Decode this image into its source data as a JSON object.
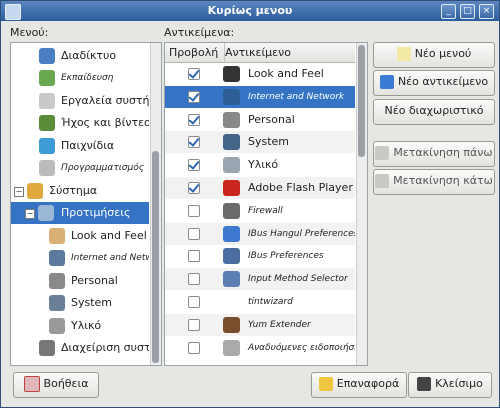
{
  "window": {
    "title": "Κυρίως μενου"
  },
  "menus_panel": {
    "label": "Μενού:",
    "items": [
      {
        "label": "Διαδίκτυο",
        "icon": "internet-globe-icon"
      },
      {
        "label": "Εκπαίδευση",
        "icon": "education-icon"
      },
      {
        "label": "Εργαλεία συστήμ",
        "icon": "system-tools-icon"
      },
      {
        "label": "Ήχος και βίντεο",
        "icon": "sound-video-icon"
      },
      {
        "label": "Παιχνίδια",
        "icon": "games-icon"
      },
      {
        "label": "Προγραμματισμός",
        "icon": "programming-icon"
      },
      {
        "label": "Σύστημα",
        "icon": "system-icon",
        "expander": "−"
      },
      {
        "label": "Προτιμήσεις",
        "icon": "preferences-icon",
        "expander": "−"
      },
      {
        "label": "Look and Feel",
        "icon": "look-and-feel-icon"
      },
      {
        "label": "Internet and Netw",
        "icon": "internet-network-icon"
      },
      {
        "label": "Personal",
        "icon": "personal-icon"
      },
      {
        "label": "System",
        "icon": "system-settings-icon"
      },
      {
        "label": "Υλικό",
        "icon": "hardware-icon"
      },
      {
        "label": "Διαχείριση συστήμ",
        "icon": "administration-icon"
      }
    ]
  },
  "items_panel": {
    "label": "Αντικείμενα:",
    "col_show": "Προβολή",
    "col_item": "Αντικείμενο",
    "rows": [
      {
        "label": "Look and Feel",
        "checked": true,
        "icon": "look-and-feel-icon"
      },
      {
        "label": "Internet and Network",
        "checked": true,
        "icon": "internet-network-icon"
      },
      {
        "label": "Personal",
        "checked": true,
        "icon": "personal-icon"
      },
      {
        "label": "System",
        "checked": true,
        "icon": "system-settings-icon"
      },
      {
        "label": "Υλικό",
        "checked": true,
        "icon": "hardware-icon"
      },
      {
        "label": "Adobe Flash Player",
        "checked": true,
        "icon": "flash-icon"
      },
      {
        "label": "Firewall",
        "checked": false,
        "icon": "firewall-icon"
      },
      {
        "label": "IBus Hangul Preferences",
        "checked": false,
        "icon": "ibus-hangul-icon"
      },
      {
        "label": "IBus Preferences",
        "checked": false,
        "icon": "ibus-icon"
      },
      {
        "label": "Input Method Selector",
        "checked": false,
        "icon": "input-method-icon"
      },
      {
        "label": "tintwizard",
        "checked": false,
        "icon": "blank-icon"
      },
      {
        "label": "Yum Extender",
        "checked": false,
        "icon": "yum-extender-icon"
      },
      {
        "label": "Αναδυόμενες ειδοποιήσεις",
        "checked": false,
        "icon": "notifications-icon"
      }
    ]
  },
  "buttons": {
    "new_menu": "Νέο μενού",
    "new_item": "Νέο αντικείμενο",
    "new_separator": "Νέο διαχωριστικό",
    "move_up": "Μετακίνηση πάνω",
    "move_down": "Μετακίνηση κάτω",
    "help": "Βοήθεια",
    "revert": "Επαναφορά",
    "close": "Κλείσιμο"
  },
  "colors": {
    "selection": "#3574c5",
    "titlebar": "#2b5d9c"
  }
}
